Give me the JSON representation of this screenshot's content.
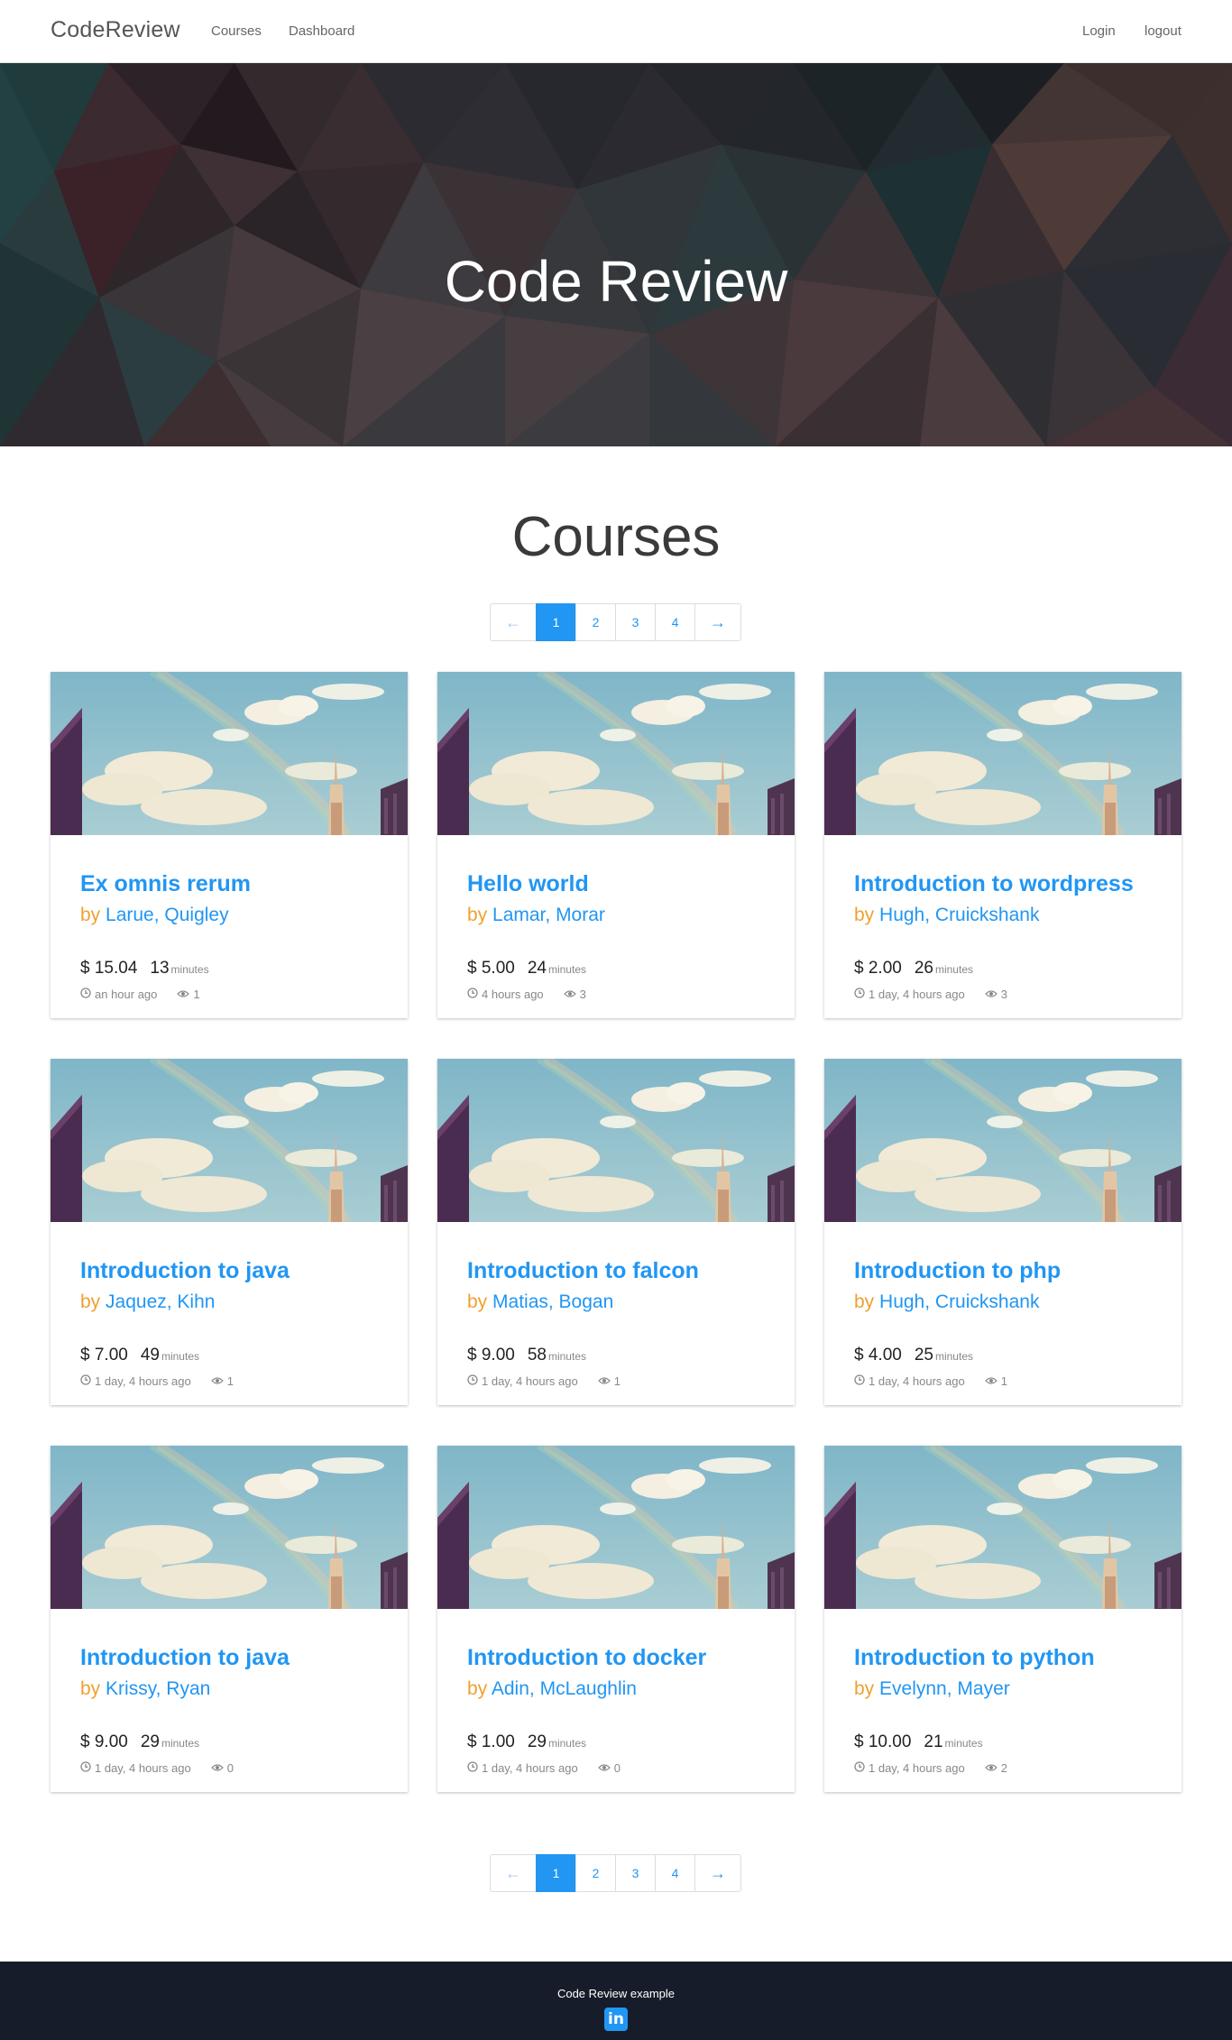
{
  "navbar": {
    "brand": "CodeReview",
    "links": [
      "Courses",
      "Dashboard"
    ],
    "right_links": [
      "Login",
      "logout"
    ]
  },
  "hero": {
    "title": "Code Review"
  },
  "section": {
    "title": "Courses"
  },
  "pagination": {
    "prev": "←",
    "next": "→",
    "pages": [
      "1",
      "2",
      "3",
      "4"
    ],
    "active_page": "1"
  },
  "courses": [
    {
      "title": "Ex omnis rerum",
      "by": "by",
      "authors": "Larue, Quigley",
      "price": "$ 15.04",
      "duration": "13",
      "unit": "minutes",
      "time": "an hour ago",
      "views": "1"
    },
    {
      "title": "Hello world",
      "by": "by",
      "authors": "Lamar, Morar",
      "price": "$ 5.00",
      "duration": "24",
      "unit": "minutes",
      "time": "4 hours ago",
      "views": "3"
    },
    {
      "title": "Introduction to wordpress",
      "by": "by",
      "authors": "Hugh, Cruickshank",
      "price": "$ 2.00",
      "duration": "26",
      "unit": "minutes",
      "time": "1 day, 4 hours ago",
      "views": "3"
    },
    {
      "title": "Introduction to java",
      "by": "by",
      "authors": "Jaquez, Kihn",
      "price": "$ 7.00",
      "duration": "49",
      "unit": "minutes",
      "time": "1 day, 4 hours ago",
      "views": "1"
    },
    {
      "title": "Introduction to falcon",
      "by": "by",
      "authors": "Matias, Bogan",
      "price": "$ 9.00",
      "duration": "58",
      "unit": "minutes",
      "time": "1 day, 4 hours ago",
      "views": "1"
    },
    {
      "title": "Introduction to php",
      "by": "by",
      "authors": "Hugh, Cruickshank",
      "price": "$ 4.00",
      "duration": "25",
      "unit": "minutes",
      "time": "1 day, 4 hours ago",
      "views": "1"
    },
    {
      "title": "Introduction to java",
      "by": "by",
      "authors": "Krissy, Ryan",
      "price": "$ 9.00",
      "duration": "29",
      "unit": "minutes",
      "time": "1 day, 4 hours ago",
      "views": "0"
    },
    {
      "title": "Introduction to docker",
      "by": "by",
      "authors": "Adin, McLaughlin",
      "price": "$ 1.00",
      "duration": "29",
      "unit": "minutes",
      "time": "1 day, 4 hours ago",
      "views": "0"
    },
    {
      "title": "Introduction to python",
      "by": "by",
      "authors": "Evelynn, Mayer",
      "price": "$ 10.00",
      "duration": "21",
      "unit": "minutes",
      "time": "1 day, 4 hours ago",
      "views": "2"
    }
  ],
  "footer": {
    "text": "Code Review example",
    "social_icon": "linkedin-icon",
    "social_label": "in"
  },
  "colors": {
    "accent": "#2196f3",
    "author_prefix": "#f0a030",
    "footer_bg": "#161c2a"
  }
}
